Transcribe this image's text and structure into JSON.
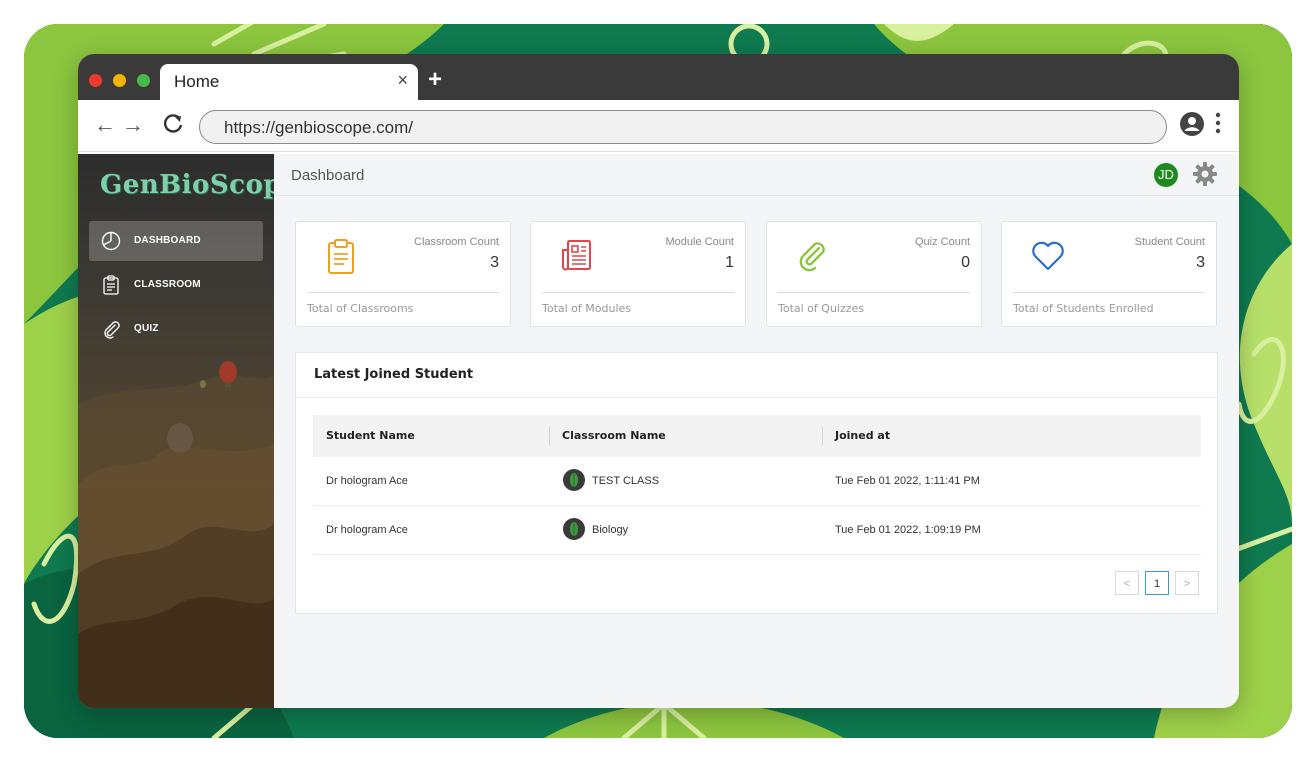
{
  "browser": {
    "tab_title": "Home",
    "tab_close": "×",
    "new_tab": "+",
    "url": "https://genbioscope.com/",
    "back": "←",
    "forward": "→",
    "reload": "C"
  },
  "sidebar": {
    "logo": "GenBioScope",
    "items": [
      {
        "label": "DASHBOARD",
        "icon": "pie-chart-icon",
        "active": true
      },
      {
        "label": "CLASSROOM",
        "icon": "clipboard-icon",
        "active": false
      },
      {
        "label": "QUIZ",
        "icon": "paperclip-icon",
        "active": false
      }
    ]
  },
  "header": {
    "title": "Dashboard",
    "avatar_initials": "JD"
  },
  "cards": [
    {
      "label": "Classroom Count",
      "value": "3",
      "footer": "Total of Classrooms",
      "icon": "clipboard-icon",
      "color": "#f0a020"
    },
    {
      "label": "Module Count",
      "value": "1",
      "footer": "Total of Modules",
      "icon": "newspaper-icon",
      "color": "#e0454a"
    },
    {
      "label": "Quiz Count",
      "value": "0",
      "footer": "Total of Quizzes",
      "icon": "paperclip-icon",
      "color": "#8cc63f"
    },
    {
      "label": "Student Count",
      "value": "3",
      "footer": "Total of Students Enrolled",
      "icon": "heart-icon",
      "color": "#2a6fc9"
    }
  ],
  "latest": {
    "title": "Latest Joined Student",
    "columns": [
      "Student Name",
      "Classroom Name",
      "Joined at"
    ],
    "rows": [
      {
        "student": "Dr hologram Ace",
        "classroom": "TEST CLASS",
        "joined": "Tue Feb 01 2022, 1:11:41 PM"
      },
      {
        "student": "Dr hologram Ace",
        "classroom": "Biology",
        "joined": "Tue Feb 01 2022, 1:09:19 PM"
      }
    ],
    "pagination": {
      "prev": "<",
      "current": "1",
      "next": ">"
    }
  }
}
